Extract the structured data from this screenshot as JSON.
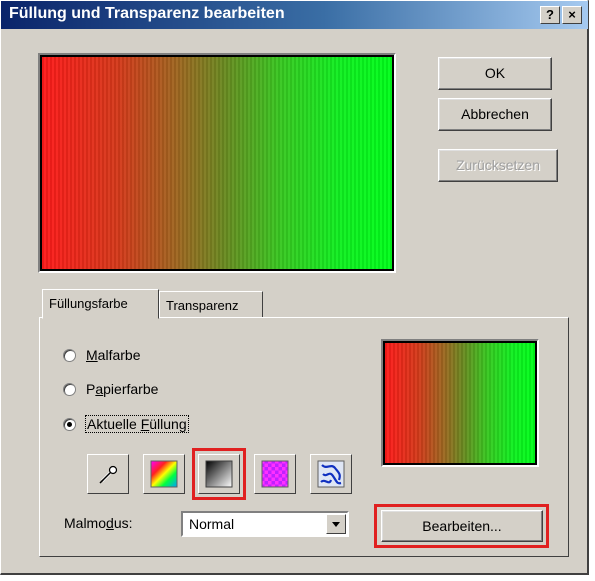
{
  "window": {
    "title": "Füllung und Transparenz bearbeiten",
    "help_button": "?",
    "close_button": "×"
  },
  "buttons": {
    "ok": "OK",
    "cancel": "Abbrechen",
    "reset": "Zurücksetzen",
    "edit": "Bearbeiten..."
  },
  "tabs": [
    {
      "label": "Füllungsfarbe",
      "active": true
    },
    {
      "label": "Transparenz",
      "active": false
    }
  ],
  "fill_options": [
    {
      "label_pre": "",
      "label_ul": "M",
      "label_post": "alfarbe",
      "checked": false
    },
    {
      "label_pre": "P",
      "label_ul": "a",
      "label_post": "pierfarbe",
      "checked": false
    },
    {
      "label_pre": "Aktuelle ",
      "label_ul": "F",
      "label_post": "üllung",
      "checked": true
    }
  ],
  "tools": [
    {
      "icon": "eyedropper-icon"
    },
    {
      "icon": "color-spectrum-icon"
    },
    {
      "icon": "gradient-fill-icon",
      "highlighted": true
    },
    {
      "icon": "pattern-fill-icon"
    },
    {
      "icon": "texture-fill-icon"
    }
  ],
  "paint_mode": {
    "label_pre": "Malmo",
    "label_ul": "d",
    "label_post": "us:",
    "value": "Normal"
  },
  "colors": {
    "highlight": "#e02020",
    "gradient_start": "#ff1a1a",
    "gradient_end": "#00ff1a"
  }
}
